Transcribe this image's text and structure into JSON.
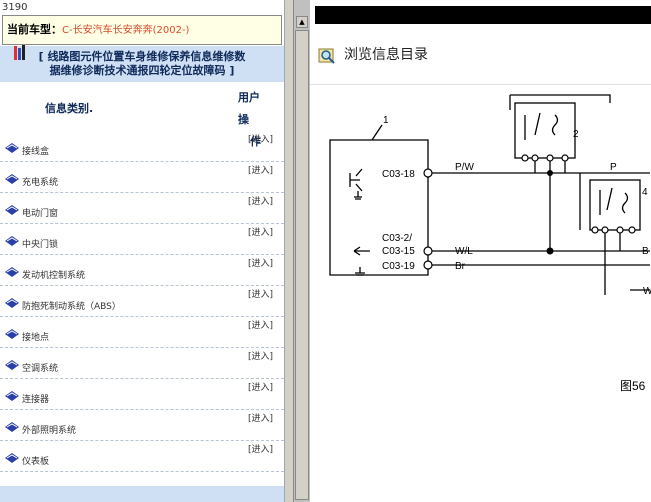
{
  "topbar": {
    "id": "3190"
  },
  "car_model": {
    "label": "当前车型：",
    "value": "C-长安汽车长安奔奔(2002-)"
  },
  "links": {
    "bracket_open": "[",
    "line1": "线路图元件位置车身维修保养信息维修数",
    "line2": "据维修诊断技术通报四轮定位故障码",
    "bracket_close": "]"
  },
  "table": {
    "col_type": "信息类别.",
    "col_op_line1": "用户操",
    "col_op_line2": "作",
    "rows": [
      {
        "name": "接线盒",
        "action": "[进入]"
      },
      {
        "name": "充电系统",
        "action": "[进入]"
      },
      {
        "name": "电动门窗",
        "action": "[进入]"
      },
      {
        "name": "中央门锁",
        "action": "[进入]"
      },
      {
        "name": "发动机控制系统",
        "action": "[进入]"
      },
      {
        "name": "防抱死制动系统（ABS）",
        "action": "[进入]"
      },
      {
        "name": "接地点",
        "action": "[进入]"
      },
      {
        "name": "空调系统",
        "action": "[进入]"
      },
      {
        "name": "连接器",
        "action": "[进入]"
      },
      {
        "name": "外部照明系统",
        "action": "[进入]"
      },
      {
        "name": "仪表板",
        "action": "[进入]"
      }
    ]
  },
  "right_panel": {
    "title": "浏览信息目录"
  },
  "diagram": {
    "label1": "1",
    "label2": "2",
    "label4": "4",
    "c0318": "C03-18",
    "pw": "P/W",
    "p": "P",
    "c032": "C03-2/",
    "c0315": "C03-15",
    "wl": "W/L",
    "c0319": "C03-19",
    "br": "Br",
    "b": "B",
    "w": "W",
    "fig": "图56"
  },
  "colors": {
    "accent": "#cfe0f5",
    "link_text": "#102a5a",
    "model_value": "#d84b2a"
  }
}
